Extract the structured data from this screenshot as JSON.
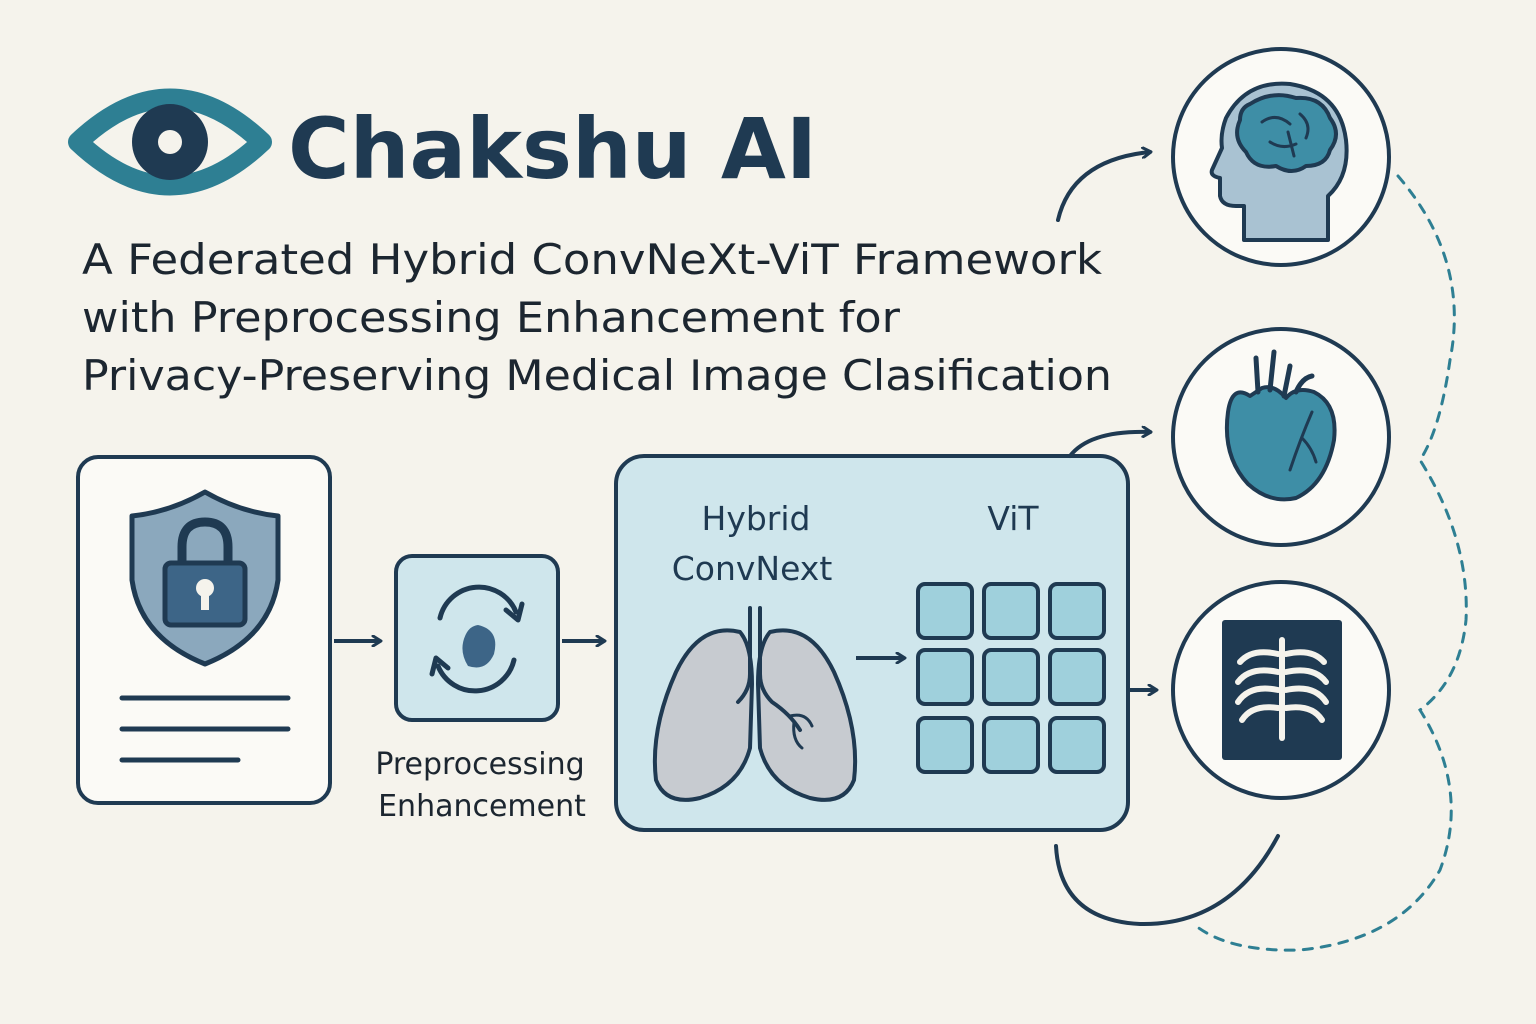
{
  "brand": {
    "name": "Chakshu AI",
    "logo_icon": "eye-icon"
  },
  "subtitle": {
    "line1": "A Federated Hybrid ConvNeXt-ViT Framework",
    "line2": "with Preprocessing Enhancement for",
    "line3": "Privacy-Preserving Medical Image Clasification"
  },
  "pipeline": {
    "input_card": {
      "icons": [
        "shield-icon",
        "lock-icon",
        "document-lines-icon"
      ]
    },
    "preprocessing": {
      "label_line1": "Preprocessing",
      "label_line2": "Enhancement",
      "icon": "refresh-cycle-icon"
    },
    "model": {
      "convnext_line1": "Hybrid",
      "convnext_line2": "ConvNext",
      "vit_label": "ViT",
      "icons": [
        "lungs-icon",
        "patch-grid-icon"
      ]
    },
    "outputs": [
      {
        "icon": "brain-head-icon"
      },
      {
        "icon": "heart-icon"
      },
      {
        "icon": "chest-xray-icon"
      }
    ]
  },
  "colors": {
    "background": "#f5f3ec",
    "navy": "#1f3a52",
    "teal": "#2e7f93",
    "light_panel": "#cfe6ec",
    "patch_fill": "#9fd0dc",
    "organ_gray": "#c7cbd0",
    "shield_fill": "#8ba8bd",
    "head_fill": "#a9c2d2"
  }
}
